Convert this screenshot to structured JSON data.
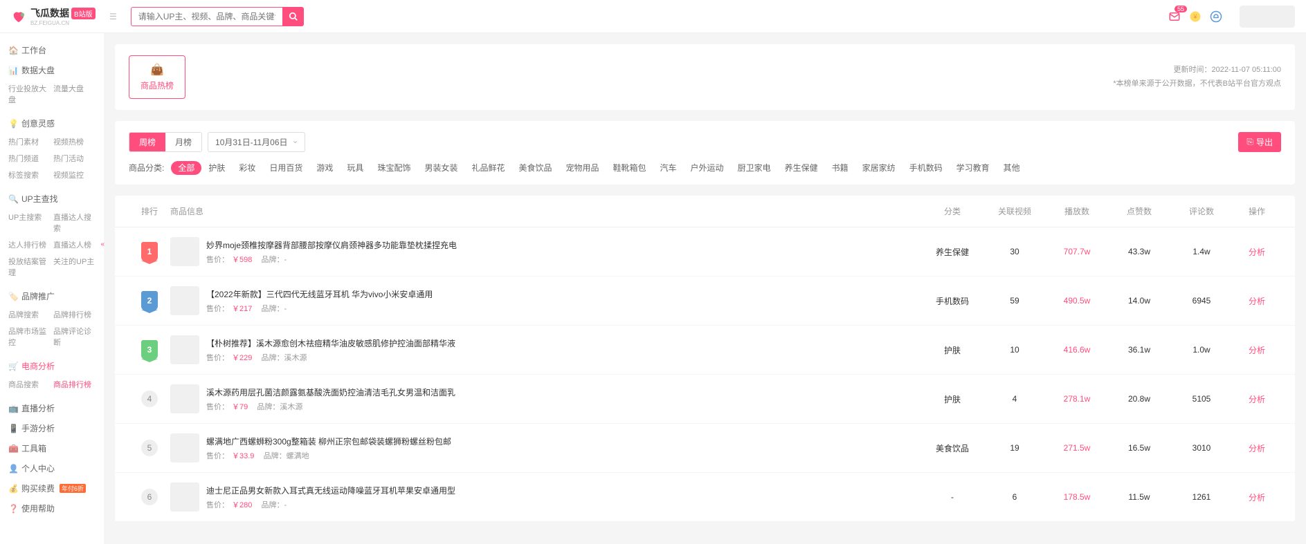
{
  "logo": {
    "text": "飞瓜数据",
    "sub": "BZ.FEIGUA.CN",
    "badge": "B站版"
  },
  "search": {
    "placeholder": "请输入UP主、视频、品牌、商品关键词搜索"
  },
  "topbar": {
    "notif_count": "55"
  },
  "sidebar": {
    "items": [
      {
        "label": "工作台",
        "sub": []
      },
      {
        "label": "数据大盘",
        "sub": [
          "行业投放大盘",
          "流量大盘"
        ]
      },
      {
        "label": "创意灵感",
        "sub": [
          "热门素材",
          "视频热榜",
          "热门频道",
          "热门活动",
          "标签搜索",
          "视频监控"
        ]
      },
      {
        "label": "UP主查找",
        "sub": [
          "UP主搜索",
          "直播达人搜索",
          "达人排行榜",
          "直播达人榜",
          "投放结案管理",
          "关注的UP主"
        ]
      },
      {
        "label": "品牌推广",
        "sub": [
          "品牌搜索",
          "品牌排行榜",
          "品牌市场监控",
          "品牌评论诊断"
        ]
      },
      {
        "label": "电商分析",
        "active": true,
        "sub": [
          "商品搜索",
          "商品排行榜"
        ],
        "sub_active": 1
      },
      {
        "label": "直播分析",
        "sub": []
      },
      {
        "label": "手游分析",
        "sub": []
      },
      {
        "label": "工具箱",
        "sub": []
      },
      {
        "label": "个人中心",
        "sub": []
      },
      {
        "label": "购买续费",
        "tag": "年付6折",
        "sub": []
      },
      {
        "label": "使用帮助",
        "sub": []
      }
    ]
  },
  "header": {
    "hot_label": "商品热榜",
    "update_label": "更新时间：",
    "update_time": "2022-11-07 05:11:00",
    "disclaimer": "*本榜单来源于公开数据，不代表B站平台官方观点"
  },
  "filters": {
    "tabs": [
      "周榜",
      "月榜"
    ],
    "tab_active": 0,
    "date": "10月31日-11月06日",
    "export": "导出",
    "cat_label": "商品分类:",
    "cats": [
      "全部",
      "护肤",
      "彩妆",
      "日用百货",
      "游戏",
      "玩具",
      "珠宝配饰",
      "男装女装",
      "礼品鲜花",
      "美食饮品",
      "宠物用品",
      "鞋靴箱包",
      "汽车",
      "户外运动",
      "厨卫家电",
      "养生保健",
      "书籍",
      "家居家纺",
      "手机数码",
      "学习教育",
      "其他"
    ],
    "cat_active": 0
  },
  "table": {
    "headers": {
      "rank": "排行",
      "info": "商品信息",
      "cat": "分类",
      "videos": "关联视频",
      "plays": "播放数",
      "likes": "点赞数",
      "comments": "评论数",
      "op": "操作"
    },
    "price_label": "售价：",
    "brand_label": "品牌：",
    "op_text": "分析",
    "rows": [
      {
        "rank": 1,
        "title": "妙界moje颈椎按摩器背部腰部按摩仪肩颈神器多功能靠垫枕揉捏充电",
        "price": "￥598",
        "brand": "-",
        "cat": "养生保健",
        "videos": "30",
        "plays": "707.7w",
        "likes": "43.3w",
        "comments": "1.4w"
      },
      {
        "rank": 2,
        "title": "【2022年新款】三代四代无线蓝牙耳机 华为vivo小米安卓通用",
        "price": "￥217",
        "brand": "-",
        "cat": "手机数码",
        "videos": "59",
        "plays": "490.5w",
        "likes": "14.0w",
        "comments": "6945"
      },
      {
        "rank": 3,
        "title": "【朴树推荐】溪木源愈创木祛痘精华油皮敏感肌修护控油面部精华液",
        "price": "￥229",
        "brand": "溪木源",
        "cat": "护肤",
        "videos": "10",
        "plays": "416.6w",
        "likes": "36.1w",
        "comments": "1.0w"
      },
      {
        "rank": 4,
        "title": "溪木源药用层孔菌洁颜露氨基酸洗面奶控油清洁毛孔女男温和洁面乳",
        "price": "￥79",
        "brand": "溪木源",
        "cat": "护肤",
        "videos": "4",
        "plays": "278.1w",
        "likes": "20.8w",
        "comments": "5105"
      },
      {
        "rank": 5,
        "title": "螺满地广西螺蛳粉300g整箱装 柳州正宗包邮袋装螺狮粉螺丝粉包邮",
        "price": "￥33.9",
        "brand": "螺满地",
        "cat": "美食饮品",
        "videos": "19",
        "plays": "271.5w",
        "likes": "16.5w",
        "comments": "3010"
      },
      {
        "rank": 6,
        "title": "迪士尼正品男女新款入耳式真无线运动降噪蓝牙耳机苹果安卓通用型",
        "price": "￥280",
        "brand": "-",
        "cat": "-",
        "videos": "6",
        "plays": "178.5w",
        "likes": "11.5w",
        "comments": "1261"
      }
    ]
  }
}
